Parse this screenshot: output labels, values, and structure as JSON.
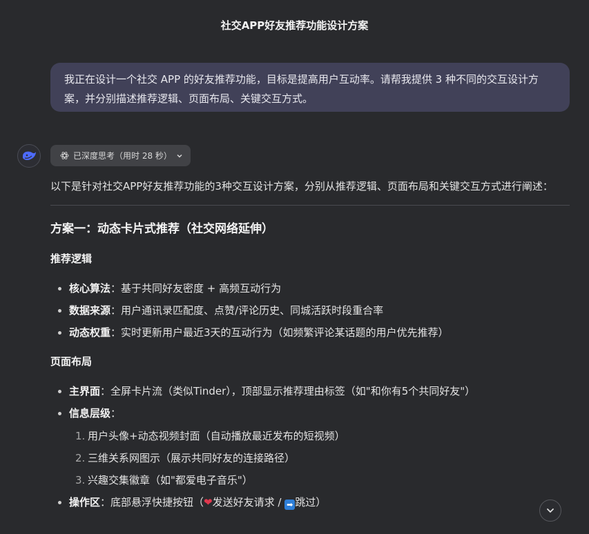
{
  "header": {
    "title": "社交APP好友推荐功能设计方案"
  },
  "user_message": {
    "text": "我正在设计一个社交 APP 的好友推荐功能，目标是提高用户互动率。请帮我提供 3 种不同的交互设计方案，并分别描述推荐逻辑、页面布局、关键交互方式。"
  },
  "assistant": {
    "thinking_label": "已深度思考（用时 28 秒）",
    "intro": "以下是针对社交APP好友推荐功能的3种交互设计方案，分别从推荐逻辑、页面布局和关键交互方式进行阐述：",
    "plan1": {
      "heading": "方案一：动态卡片式推荐（社交网络延伸）",
      "logic_heading": "推荐逻辑",
      "logic_items": [
        {
          "label": "核心算法",
          "text": "：基于共同好友密度 + 高频互动行为"
        },
        {
          "label": "数据来源",
          "text": "：用户通讯录匹配度、点赞/评论历史、同城活跃时段重合率"
        },
        {
          "label": "动态权重",
          "text": "：实时更新用户最近3天的互动行为（如频繁评论某话题的用户优先推荐）"
        }
      ],
      "layout_heading": "页面布局",
      "layout_main": {
        "label": "主界面",
        "text": "：全屏卡片流（类似Tinder），顶部显示推荐理由标签（如\"和你有5个共同好友\"）"
      },
      "layout_info": {
        "label": "信息层级",
        "text": "："
      },
      "info_items": [
        {
          "num": "1.",
          "text": "用户头像+动态视频封面（自动播放最近发布的短视频）"
        },
        {
          "num": "2.",
          "text": "三维关系网图示（展示共同好友的连接路径）"
        },
        {
          "num": "3.",
          "text": "兴趣交集徽章（如\"都爱电子音乐\"）"
        }
      ],
      "layout_ops": {
        "label": "操作区",
        "text_a": "：底部悬浮快捷按钮（",
        "text_b": "发送好友请求 / ",
        "text_c": "跳过）"
      }
    }
  },
  "icons": {
    "avatar": "deepseek-whale-icon",
    "think": "atom-icon",
    "chevron": "chevron-down-icon",
    "heart": "❤",
    "arrow": "➡"
  },
  "colors": {
    "background": "#292a2d",
    "user_bubble": "#414158",
    "chip": "#414246"
  }
}
